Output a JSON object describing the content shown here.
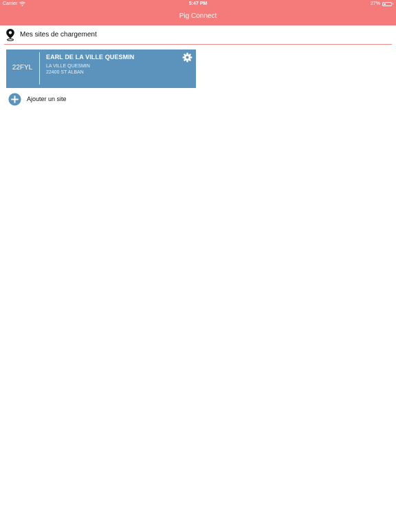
{
  "status_bar": {
    "carrier": "Carrier",
    "time": "5:47 PM",
    "battery": "27%",
    "battery_level": 0.27
  },
  "header": {
    "title": "Pig Connect",
    "color": "#f47b79"
  },
  "section": {
    "title": "Mes sites de chargement",
    "icon": "map-pin-icon"
  },
  "sites": [
    {
      "code": "22FYL",
      "name": "EARL DE LA VILLE QUESMIN",
      "address_line1": "LA VILLE QUESMIN",
      "address_line2": "22400 ST ALBAN",
      "settings_icon": "gear-icon",
      "color": "#5b93bd"
    }
  ],
  "add_site": {
    "label": "Ajouter un site",
    "icon": "plus-circle-icon",
    "color": "#5b93bd"
  }
}
